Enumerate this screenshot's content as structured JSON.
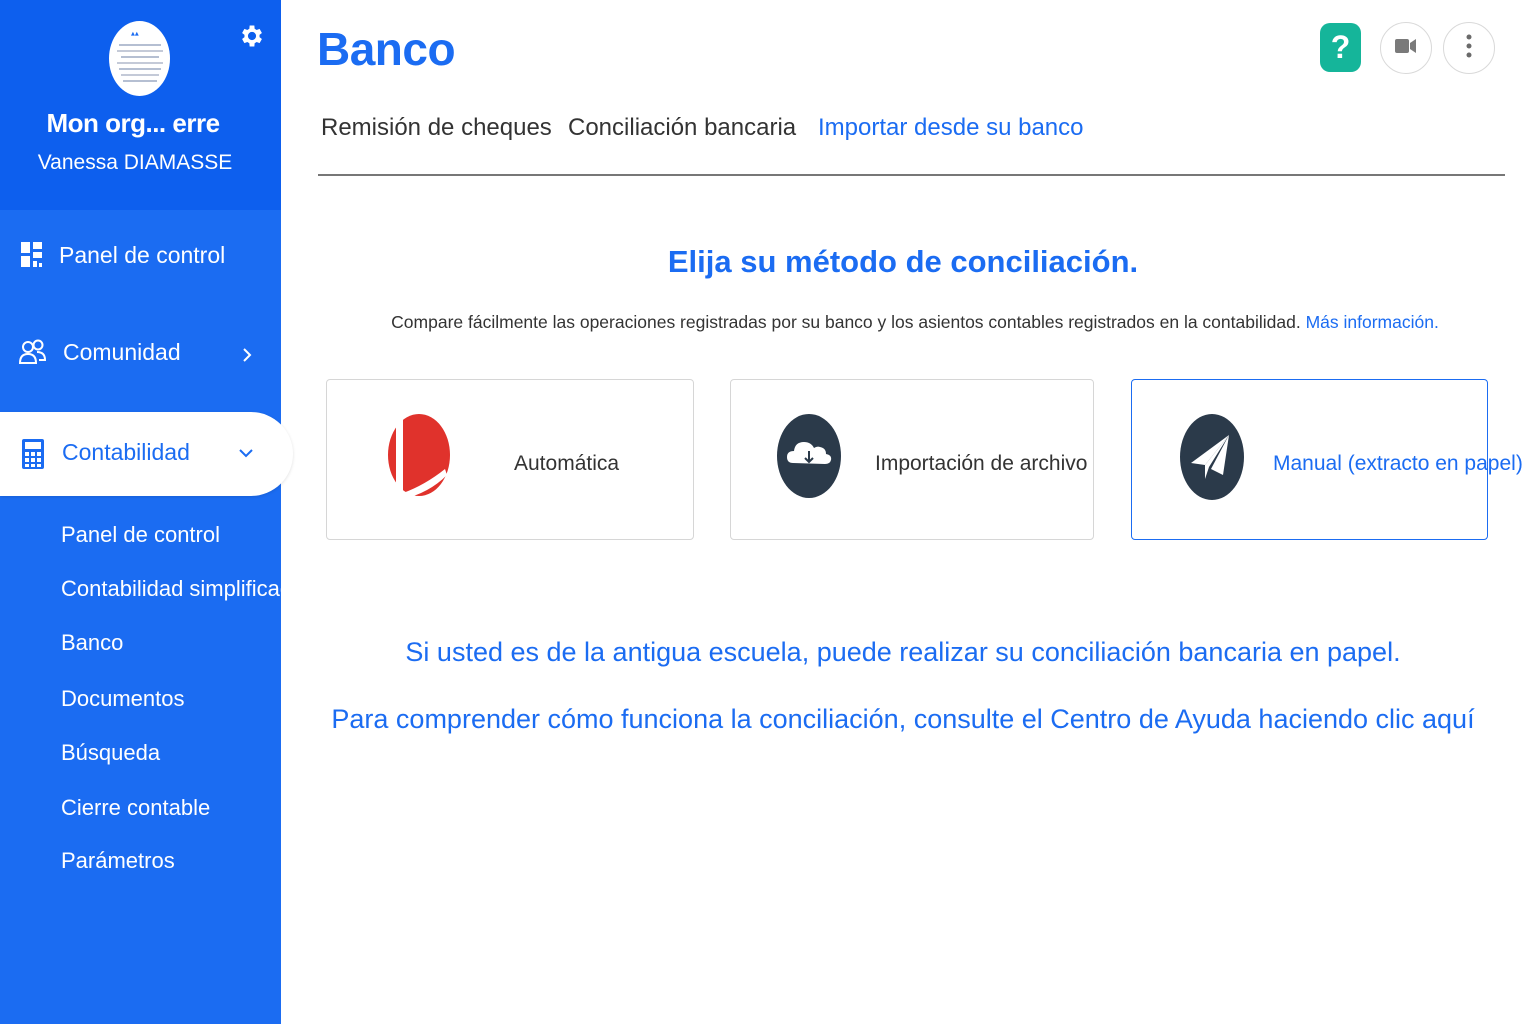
{
  "sidebar": {
    "org_name": "Mon org... erre",
    "user_name": "Vanessa DIAMASSE",
    "items": [
      {
        "label": "Panel de control",
        "icon": "dashboard-icon"
      },
      {
        "label": "Comunidad",
        "icon": "users-icon"
      },
      {
        "label": "Contabilidad",
        "icon": "calculator-icon",
        "active": true
      }
    ],
    "sub_items": [
      {
        "label": "Panel de control"
      },
      {
        "label": "Contabilidad simplificada"
      },
      {
        "label": "Banco"
      },
      {
        "label": "Documentos"
      },
      {
        "label": "Búsqueda"
      },
      {
        "label": "Cierre contable"
      },
      {
        "label": "Parámetros"
      }
    ]
  },
  "header": {
    "title": "Banco",
    "help_label": "?"
  },
  "tabs": [
    {
      "label": "Remisión de cheques"
    },
    {
      "label": "Conciliación bancaria"
    },
    {
      "label": "Importar desde su banco",
      "active": true
    }
  ],
  "main": {
    "title": "Elija su método de conciliación.",
    "description": "Compare fácilmente las operaciones registradas por su banco y los asientos contables registrados en la contabilidad.",
    "more_info_link": "Más información.",
    "cards": [
      {
        "label": "Automática",
        "icon": "automatic-logo-icon"
      },
      {
        "label": "Importación de archivo",
        "icon": "cloud-download-icon"
      },
      {
        "label": "Manual (extracto en papel)",
        "icon": "paper-plane-icon",
        "selected": true
      }
    ],
    "old_school_text": "Si usted es de la antigua escuela, puede realizar su conciliación bancaria en papel.",
    "help_center_text": "Para comprender cómo funciona la conciliación, consulte el Centro de Ayuda haciendo clic aquí"
  },
  "colors": {
    "brand": "#1b6cf2",
    "sidebar_head": "#0d5fee",
    "help": "#15b59a",
    "icon_dark": "#2b3a4a",
    "automatic_red": "#e0322c"
  }
}
